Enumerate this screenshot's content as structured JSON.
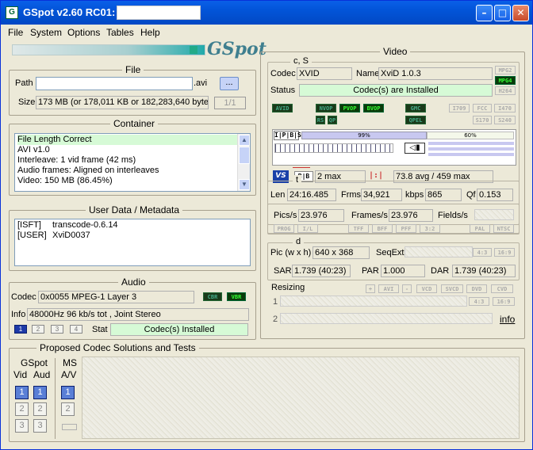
{
  "window": {
    "title": "GSpot v2.60 RC01:",
    "logo": "GSpot",
    "icon": "g-icon"
  },
  "menu": [
    "File",
    "System",
    "Options",
    "Tables",
    "Help"
  ],
  "file": {
    "label": "File",
    "path_label": "Path",
    "path_ext": ".avi",
    "browse": "...",
    "size_label": "Size",
    "size_value": "173 MB (or 178,011 KB or 182,283,640 bytes",
    "counter": "1/1"
  },
  "container": {
    "label": "Container",
    "items": [
      "File Length Correct",
      "AVI v1.0",
      "Interleave: 1 vid frame (42 ms)",
      "Audio frames: Aligned on interleaves",
      "Video: 150 MB (86.45%)"
    ]
  },
  "userdata": {
    "label": "User Data / Metadata",
    "rows": [
      [
        "[ISFT]",
        "transcode-0.6.14"
      ],
      [
        "[USER]",
        "XviD0037"
      ]
    ]
  },
  "audio": {
    "label": "Audio",
    "codec_label": "Codec",
    "codec_value": "0x0055 MPEG-1 Layer 3",
    "cbr": "CBR",
    "vbr": "VBR",
    "info_label": "Info",
    "info_value": "48000Hz  96 kb/s tot , Joint Stereo",
    "tracks": [
      "1",
      "2",
      "3",
      "4"
    ],
    "stat_label": "Stat",
    "stat_value": "Codec(s) Installed"
  },
  "proposed": {
    "label": "Proposed Codec Solutions and Tests",
    "gspot": "GSpot",
    "vid": "Vid",
    "aud": "Aud",
    "ms": "MS",
    "av": "A/V",
    "nums": [
      "1",
      "2",
      "3"
    ]
  },
  "video": {
    "label": "Video",
    "cs_label": "c, S",
    "codec_label": "Codec",
    "codec_value": "XVID",
    "name_label": "Name",
    "name_value": "XviD 1.0.3",
    "status_label": "Status",
    "status_value": "Codec(s) are Installed",
    "right_tags": [
      "MPG2",
      "MPG4",
      "H264"
    ],
    "flag_tags": [
      "AVID",
      "NVOP",
      "PVOP",
      "BVOP",
      "GMC",
      "RS",
      "QP",
      "QPEL"
    ],
    "std_tags": [
      "I709",
      "FCC",
      "I470",
      "S170",
      "S240"
    ],
    "ipbs": [
      "I",
      "P",
      "B",
      "S"
    ],
    "pct1": "99%",
    "pct2": "60%",
    "max_label": "2 max",
    "avg_label": "73.8 avg / 459 max",
    "t_label": "t",
    "len_label": "Len",
    "len_value": "24:16.485",
    "frms_label": "Frms",
    "frms_value": "34,921",
    "kbps_label": "kbps",
    "kbps_value": "865",
    "qf_label": "Qf",
    "qf_value": "0.153",
    "pics_label": "Pics/s",
    "pics_value": "23.976",
    "frames_label": "Frames/s",
    "frames_value": "23.976",
    "fields_label": "Fields/s",
    "t_tags": [
      "PROG",
      "I/L",
      "TFF",
      "BFF",
      "PFF",
      "3:2",
      "PAL",
      "NTSC"
    ],
    "d_label": "d",
    "pic_label": "Pic (w x h)",
    "pic_value": "640 x 368",
    "seqext_label": "SeqExt",
    "ar_tags": [
      "4:3",
      "16:9"
    ],
    "sar_label": "SAR",
    "sar_value": "1.739 (40:23)",
    "par_label": "PAR",
    "par_value": "1.000",
    "dar_label": "DAR",
    "dar_value": "1.739 (40:23)",
    "resizing_label": "Resizing",
    "resize_tags": [
      "+",
      "AVI",
      "-",
      "VCD",
      "SVCD",
      "DVD",
      "CVD"
    ],
    "row1": "1",
    "row2": "2",
    "info_link": "info"
  }
}
